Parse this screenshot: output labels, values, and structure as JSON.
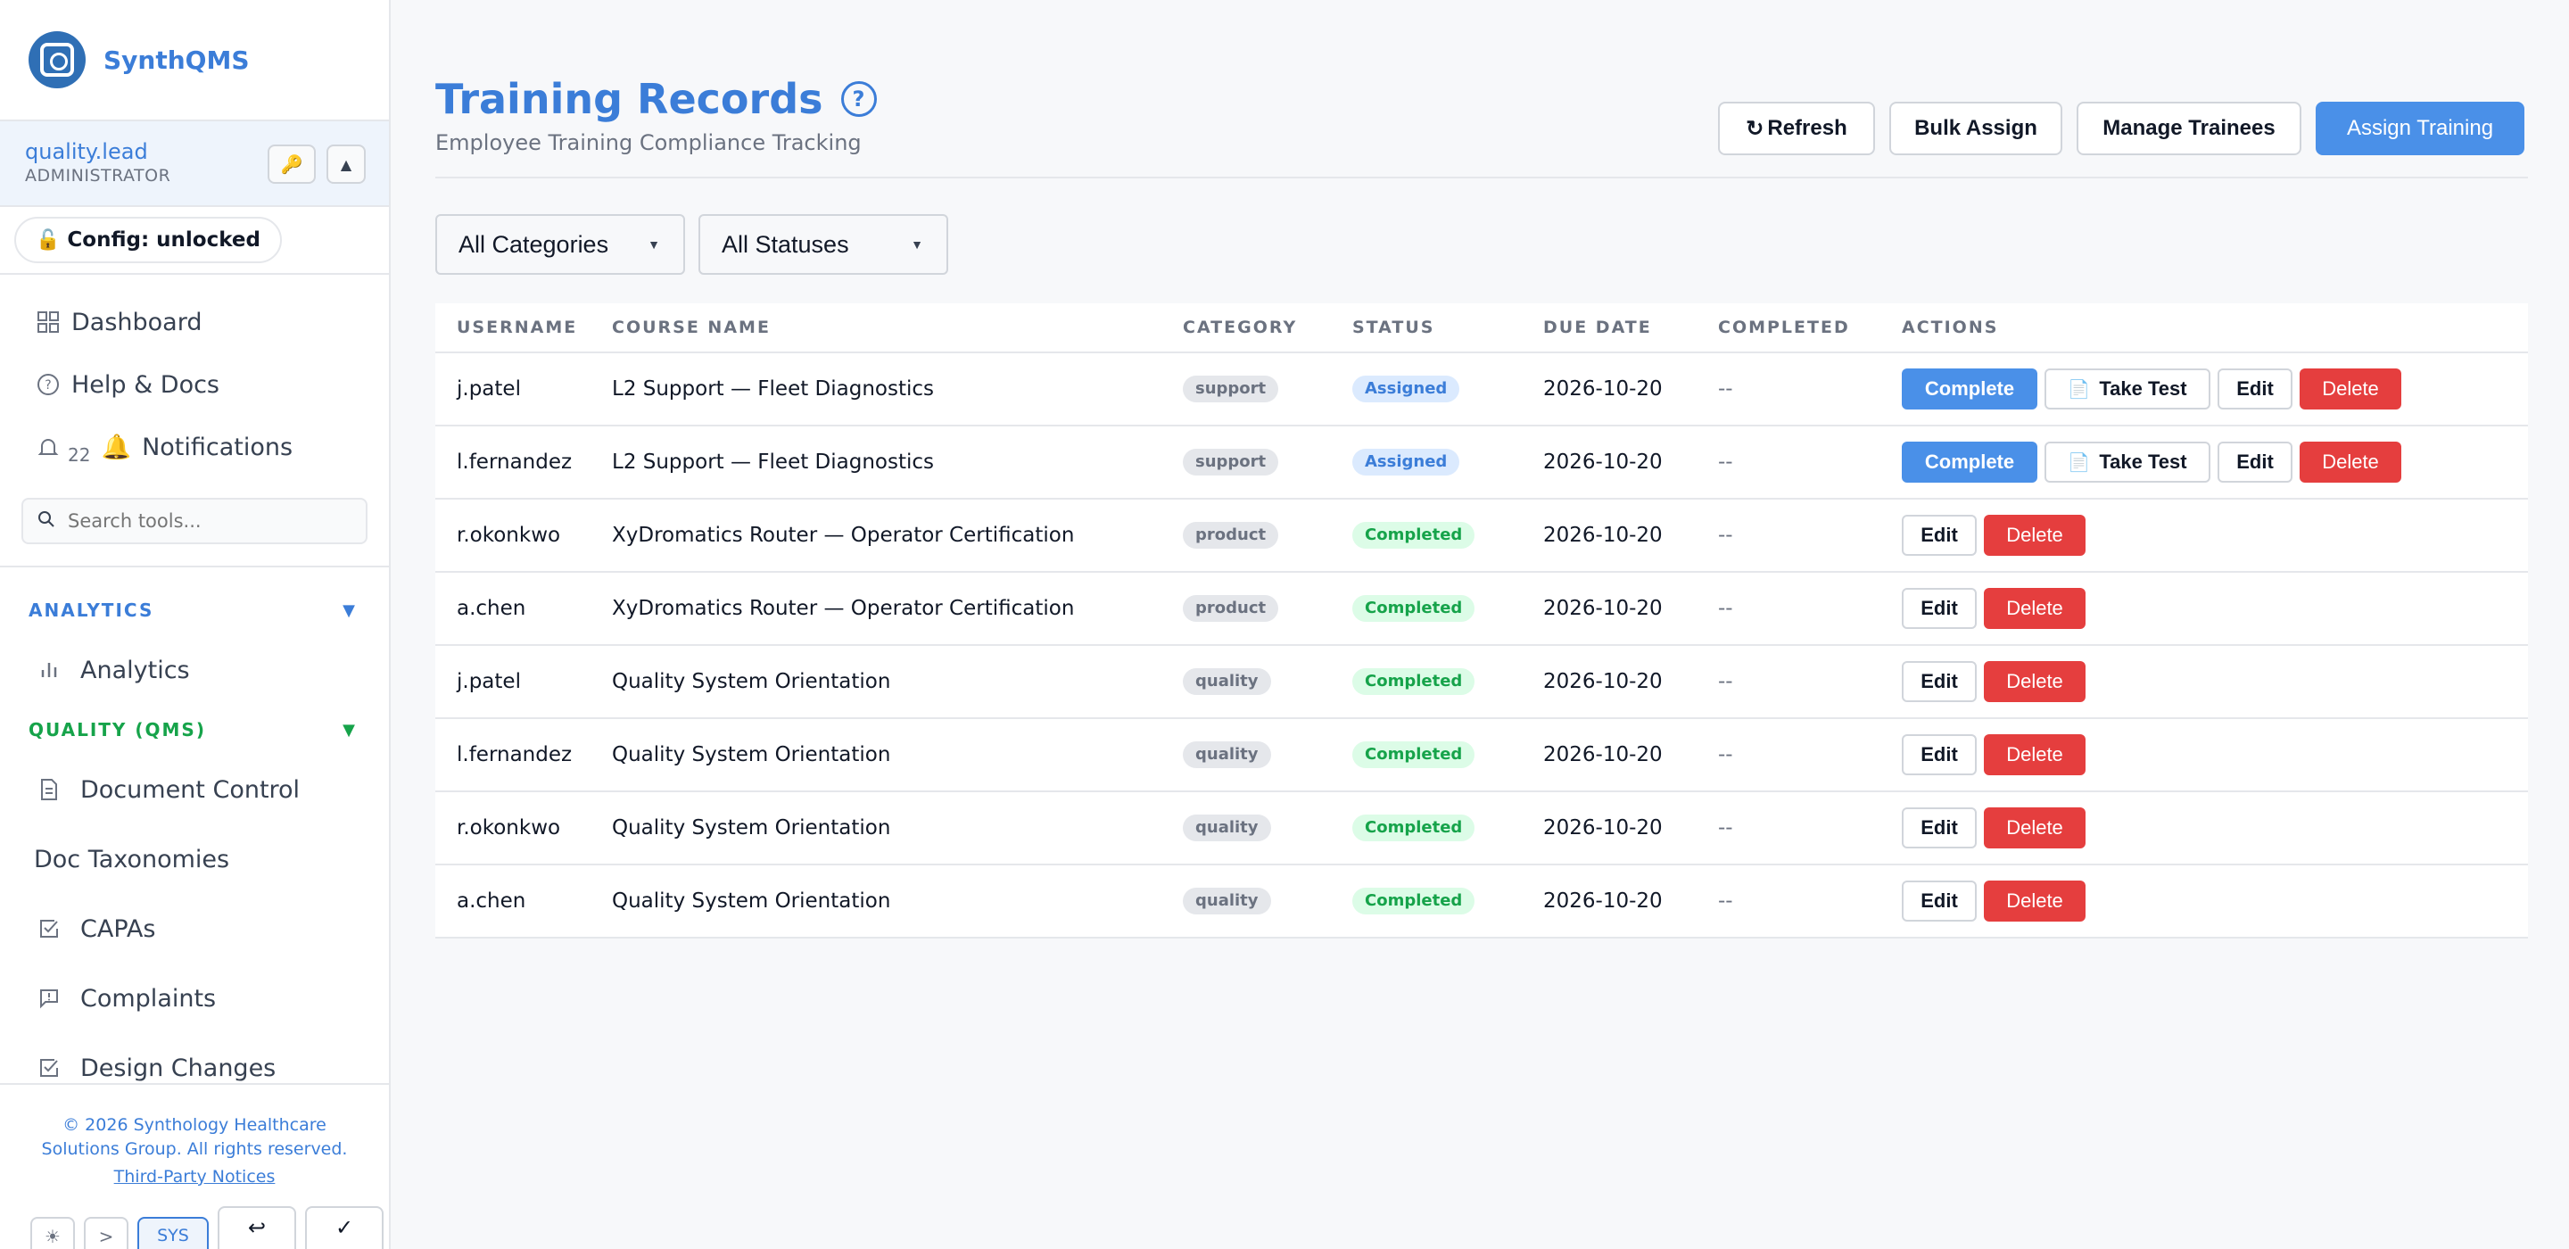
{
  "app": {
    "name": "SynthQMS"
  },
  "user": {
    "name": "quality.lead",
    "role": "ADMINISTRATOR"
  },
  "config": {
    "label": "Config: unlocked"
  },
  "nav": {
    "dashboard": "Dashboard",
    "help": "Help & Docs",
    "notifications": "Notifications",
    "notification_count": "22"
  },
  "search": {
    "placeholder": "Search tools..."
  },
  "sections": {
    "analytics": {
      "title": "ANALYTICS",
      "items": [
        "Analytics"
      ]
    },
    "quality": {
      "title": "QUALITY (QMS)",
      "items": [
        "Document Control",
        "Doc Taxonomies",
        "CAPAs",
        "Complaints",
        "Design Changes"
      ]
    }
  },
  "footer": {
    "copyright_line1": "© 2026 Synthology Healthcare",
    "copyright_line2": "Solutions Group. All rights reserved.",
    "notices": "Third-Party Notices",
    "sys_label": "SYS"
  },
  "page": {
    "title": "Training Records",
    "subtitle": "Employee Training Compliance Tracking",
    "buttons": {
      "refresh": "Refresh",
      "bulk_assign": "Bulk Assign",
      "manage_trainees": "Manage Trainees",
      "assign_training": "Assign Training"
    },
    "filters": {
      "category": "All Categories",
      "status": "All Statuses"
    }
  },
  "table": {
    "columns": [
      "USERNAME",
      "COURSE NAME",
      "CATEGORY",
      "STATUS",
      "DUE DATE",
      "COMPLETED",
      "ACTIONS"
    ],
    "actions": {
      "complete": "Complete",
      "take_test": "Take Test",
      "edit": "Edit",
      "delete": "Delete"
    },
    "rows": [
      {
        "username": "j.patel",
        "course": "L2 Support — Fleet Diagnostics",
        "category": "support",
        "status": "Assigned",
        "due": "2026-10-20",
        "completed": "--"
      },
      {
        "username": "l.fernandez",
        "course": "L2 Support — Fleet Diagnostics",
        "category": "support",
        "status": "Assigned",
        "due": "2026-10-20",
        "completed": "--"
      },
      {
        "username": "r.okonkwo",
        "course": "XyDromatics Router — Operator Certification",
        "category": "product",
        "status": "Completed",
        "due": "2026-10-20",
        "completed": "--"
      },
      {
        "username": "a.chen",
        "course": "XyDromatics Router — Operator Certification",
        "category": "product",
        "status": "Completed",
        "due": "2026-10-20",
        "completed": "--"
      },
      {
        "username": "j.patel",
        "course": "Quality System Orientation",
        "category": "quality",
        "status": "Completed",
        "due": "2026-10-20",
        "completed": "--"
      },
      {
        "username": "l.fernandez",
        "course": "Quality System Orientation",
        "category": "quality",
        "status": "Completed",
        "due": "2026-10-20",
        "completed": "--"
      },
      {
        "username": "r.okonkwo",
        "course": "Quality System Orientation",
        "category": "quality",
        "status": "Completed",
        "due": "2026-10-20",
        "completed": "--"
      },
      {
        "username": "a.chen",
        "course": "Quality System Orientation",
        "category": "quality",
        "status": "Completed",
        "due": "2026-10-20",
        "completed": "--"
      }
    ]
  },
  "colors": {
    "accent": "#3b7dd8",
    "primary_button": "#4a90e8",
    "danger": "#e53e3e",
    "success": "#16a34a"
  }
}
